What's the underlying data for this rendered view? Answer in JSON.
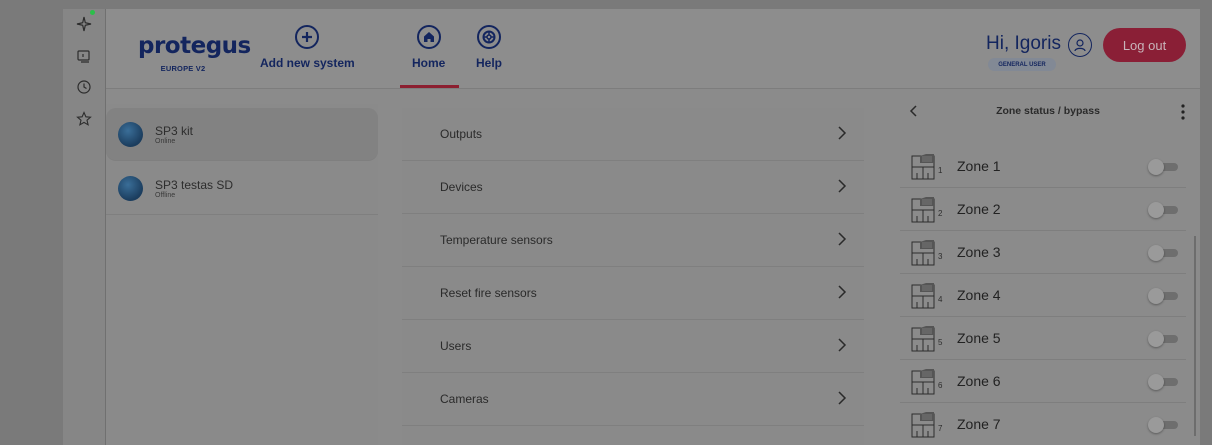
{
  "header": {
    "logo": "protegus",
    "logo_sub": "EUROPE V2",
    "nav": [
      {
        "label": "Add new system",
        "icon": "plus-circle-icon"
      },
      {
        "label": "Home",
        "icon": "home-icon"
      },
      {
        "label": "Help",
        "icon": "lifebuoy-icon"
      }
    ],
    "greeting": "Hi, Igoris",
    "role": "GENERAL USER",
    "logout_label": "Log out"
  },
  "systems": [
    {
      "name": "SP3 kit",
      "status": "Online"
    },
    {
      "name": "SP3 testas SD",
      "status": "Offline"
    }
  ],
  "menu": [
    {
      "label": "Outputs"
    },
    {
      "label": "Devices"
    },
    {
      "label": "Temperature sensors"
    },
    {
      "label": "Reset fire sensors"
    },
    {
      "label": "Users"
    },
    {
      "label": "Cameras"
    }
  ],
  "zones": {
    "title": "Zone status / bypass",
    "items": [
      {
        "num": "1",
        "name": "Zone 1"
      },
      {
        "num": "2",
        "name": "Zone 2"
      },
      {
        "num": "3",
        "name": "Zone 3"
      },
      {
        "num": "4",
        "name": "Zone 4"
      },
      {
        "num": "5",
        "name": "Zone 5"
      },
      {
        "num": "6",
        "name": "Zone 6"
      },
      {
        "num": "7",
        "name": "Zone 7"
      }
    ]
  },
  "colors": {
    "brand": "#13255e",
    "accent": "#8c1f30",
    "online_dot": "#2bbf4a"
  }
}
